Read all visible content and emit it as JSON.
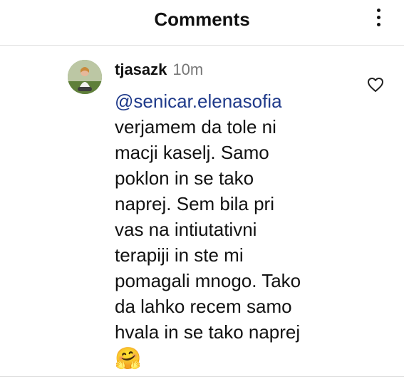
{
  "header": {
    "title": "Comments"
  },
  "comment": {
    "username": "tjasazk",
    "time": "10m",
    "mention": "@senicar.elenasofia",
    "lines": [
      "verjamem da tole ni",
      "macji kaselj. Samo",
      "poklon in se tako",
      "naprej. Sem bila pri",
      "vas na intiutativni",
      "terapiji in ste mi",
      "pomagali mnogo. Tako",
      "da lahko recem samo",
      "hvala in se tako naprej"
    ],
    "emoji": "🤗",
    "icons": {
      "menu": "more-vertical-icon",
      "like": "heart-icon"
    }
  },
  "colors": {
    "mention": "#1f3a8a",
    "timestamp": "#777777",
    "divider": "#e0e0e0"
  }
}
